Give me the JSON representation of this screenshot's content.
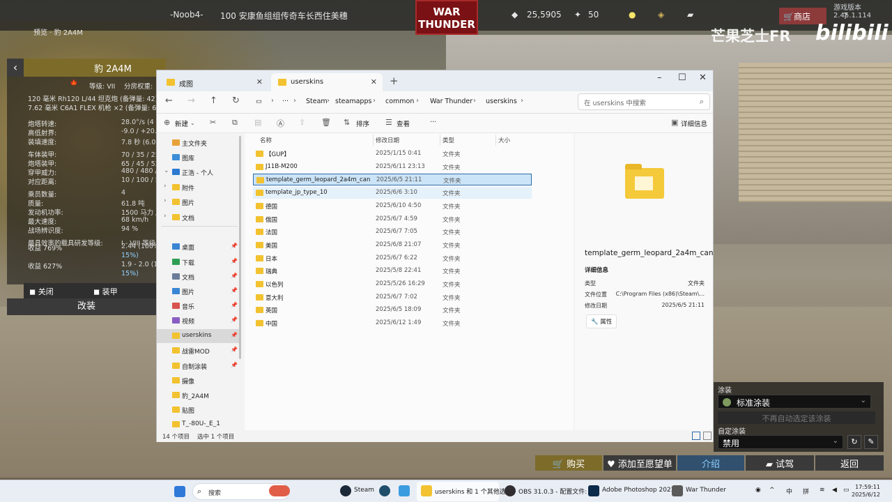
{
  "game": {
    "player_name": "-Noob4-",
    "squad_text": "100 安康鱼组组传奇车长西住美穗",
    "lions": "25,5905",
    "eagles": "50",
    "logo_line1": "WAR",
    "logo_line2": "THUNDER",
    "shop_label": "商店",
    "version": "游戏版本 2.45.1.114",
    "watermark_text": "芒果芝士FR",
    "watermark_logo": "bilibili",
    "preview_label": "预览 · 豹 2A4M"
  },
  "vehicle_panel": {
    "title": "豹 2A4M",
    "rank_label": "等级: VII",
    "br_label": "分房权重:",
    "weapon1": "120 毫米 Rh120 L/44 坦克炮 (备弹量: 42)",
    "weapon2": "7.62 毫米 C6A1 FLEX 机枪 ×2 (备弹量: 6600",
    "stats": [
      {
        "label": "炮塔转速:",
        "value": "28.0°/s (4"
      },
      {
        "label": "高低射界:",
        "value": "-9.0 / +20.0°"
      },
      {
        "label": "装填速度:",
        "value": "7.8 秒 (6.0"
      },
      {
        "label": "车体装甲:",
        "value": "70 / 35 / 25 毫"
      },
      {
        "label": "炮塔装甲:",
        "value": "65 / 45 / 52 毫"
      },
      {
        "label": "穿甲威力:",
        "value": "480 / 480 / 4"
      },
      {
        "label": "对应距离:",
        "value": "10 / 100 / 500"
      },
      {
        "label": "乘员数量:",
        "value": "4"
      },
      {
        "label": "质量:",
        "value": "61.8 吨"
      },
      {
        "label": "发动机功率:",
        "value": "1500 马力 / 1"
      },
      {
        "label": "最大速度:",
        "value": "68 km/h"
      },
      {
        "label": "战场辨识度:",
        "value": "94 %"
      },
      {
        "label": "最具效率的载具研发等级:",
        "value": "I - VIII 等级"
      }
    ],
    "reward1_label": "收益 769%",
    "reward1_value": "2.44 (100%",
    "reward1_bonus": "15%)",
    "reward2_label": "收益 627%",
    "reward2_value": "1.9 - 2.0 (100%",
    "reward2_bonus": "15%)",
    "close_label": "关闭",
    "armor_label": "装甲",
    "modify_label": "改装"
  },
  "explorer": {
    "tabs": [
      {
        "label": "成图",
        "active": false
      },
      {
        "label": "userskins",
        "active": true
      }
    ],
    "breadcrumbs": [
      "Steam",
      "steamapps",
      "common",
      "War Thunder",
      "userskins"
    ],
    "search_placeholder": "在 userskins 中搜索",
    "commands": {
      "new": "新建",
      "sort": "排序",
      "view": "查看",
      "more": "···",
      "details": "详细信息"
    },
    "nav": [
      {
        "label": "主文件夹",
        "color": "#e8a23a",
        "chev": ""
      },
      {
        "label": "图库",
        "color": "#3b8ed8",
        "chev": ""
      },
      {
        "label": "正浩 - 个人",
        "color": "#2b79d0",
        "chev": "⌄"
      },
      {
        "label": "附件",
        "color": "#f2c230",
        "chev": "›"
      },
      {
        "label": "图片",
        "color": "#f2c230",
        "chev": "›"
      },
      {
        "label": "文档",
        "color": "#f2c230",
        "chev": "›"
      },
      {
        "label": "桌面",
        "color": "#3a86d4",
        "chev": "",
        "pin": true
      },
      {
        "label": "下载",
        "color": "#2f9e55",
        "chev": "",
        "pin": true
      },
      {
        "label": "文档",
        "color": "#6b7d99",
        "chev": "",
        "pin": true
      },
      {
        "label": "图片",
        "color": "#3a86d4",
        "chev": "",
        "pin": true
      },
      {
        "label": "音乐",
        "color": "#d9534f",
        "chev": "",
        "pin": true
      },
      {
        "label": "视频",
        "color": "#8a5cc4",
        "chev": "",
        "pin": true
      },
      {
        "label": "userskins",
        "color": "#f2c230",
        "chev": "",
        "pin": true,
        "selected": true
      },
      {
        "label": "战雷MOD",
        "color": "#f2c230",
        "chev": "",
        "pin": true
      },
      {
        "label": "自制涂装",
        "color": "#f2c230",
        "chev": "",
        "pin": true
      },
      {
        "label": "摄像",
        "color": "#f2c230",
        "chev": ""
      },
      {
        "label": "豹_2A4M",
        "color": "#f2c230",
        "chev": ""
      },
      {
        "label": "贴图",
        "color": "#f2c230",
        "chev": ""
      },
      {
        "label": "T_-80U-_E_1",
        "color": "#f2c230",
        "chev": ""
      }
    ],
    "columns": {
      "name": "名称",
      "date": "修改日期",
      "type": "类型",
      "size": "大小"
    },
    "files": [
      {
        "name": "【GUP】",
        "date": "2025/1/15 0:41",
        "type": "文件夹"
      },
      {
        "name": "J11B-M200",
        "date": "2025/6/11 23:13",
        "type": "文件夹"
      },
      {
        "name": "template_germ_leopard_2a4m_can",
        "date": "2025/6/5 21:11",
        "type": "文件夹",
        "selected": true
      },
      {
        "name": "template_jp_type_10",
        "date": "2025/6/6 3:10",
        "type": "文件夹",
        "hover": true
      },
      {
        "name": "德国",
        "date": "2025/6/10 4:50",
        "type": "文件夹"
      },
      {
        "name": "俄国",
        "date": "2025/6/7 4:59",
        "type": "文件夹"
      },
      {
        "name": "法国",
        "date": "2025/6/7 7:05",
        "type": "文件夹"
      },
      {
        "name": "美国",
        "date": "2025/6/8 21:07",
        "type": "文件夹"
      },
      {
        "name": "日本",
        "date": "2025/6/7 6:22",
        "type": "文件夹"
      },
      {
        "name": "瑞典",
        "date": "2025/5/8 22:41",
        "type": "文件夹"
      },
      {
        "name": "以色列",
        "date": "2025/5/26 16:29",
        "type": "文件夹"
      },
      {
        "name": "意大利",
        "date": "2025/6/7 7:02",
        "type": "文件夹"
      },
      {
        "name": "英国",
        "date": "2025/6/5 18:09",
        "type": "文件夹"
      },
      {
        "name": "中国",
        "date": "2025/6/12 1:49",
        "type": "文件夹"
      }
    ],
    "details": {
      "title": "template_germ_leopard_2a4m_can",
      "subtitle": "详细信息",
      "rows": [
        {
          "k": "类型",
          "v": "文件夹"
        },
        {
          "k": "文件位置",
          "v": "C:\\Program Files (x86)\\Steam\\..."
        },
        {
          "k": "修改日期",
          "v": "2025/6/5 21:11"
        }
      ],
      "properties_label": "属性"
    },
    "status": {
      "count": "14 个项目",
      "selected": "选中 1 个项目"
    }
  },
  "skin_panel": {
    "skin_label": "涂装",
    "skin_value": "标准涂装",
    "disabled_text": "不再自动选定该涂装",
    "custom_label": "自定涂装",
    "custom_value": "禁用"
  },
  "bottom_bar": {
    "buy": "购买",
    "wishlist": "添加至愿望单",
    "intro": "介绍",
    "test": "试驾",
    "back": "返回"
  },
  "taskbar": {
    "search": "搜索",
    "items": [
      "Steam",
      "userskins 和 1 个其他选",
      "OBS 31.0.3 - 配置文件: 未",
      "Adobe Photoshop 2023",
      "War Thunder"
    ],
    "ime1": "中",
    "ime2": "拼",
    "time": "17:59:11",
    "date": "2025/6/12"
  }
}
